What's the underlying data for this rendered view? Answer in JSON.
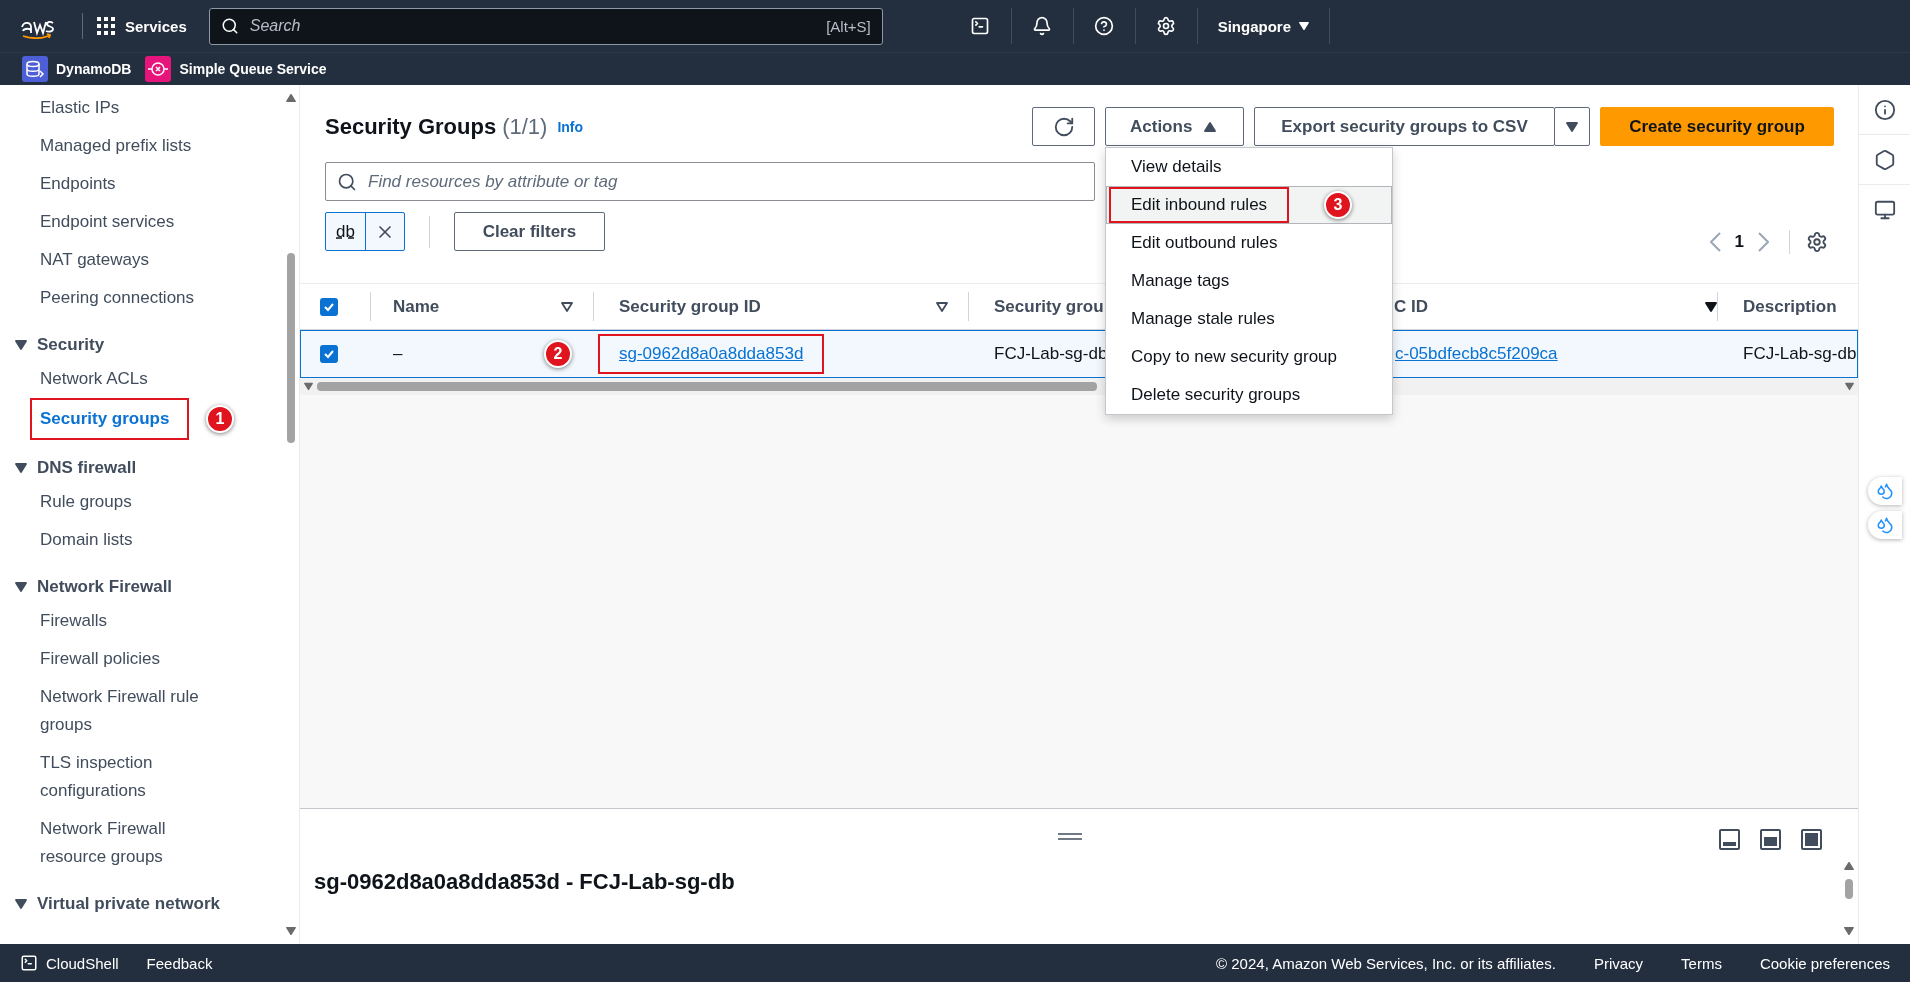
{
  "top_bar": {
    "services": "Services",
    "search": {
      "placeholder": "Search",
      "shortcut": "[Alt+S]"
    },
    "region": "Singapore"
  },
  "favorites": [
    {
      "kind": "dynamodb",
      "label": "DynamoDB"
    },
    {
      "kind": "sqs",
      "label": "Simple Queue Service"
    }
  ],
  "sidebar": {
    "items": [
      {
        "label": "Elastic IPs",
        "selected": false
      },
      {
        "label": "Managed prefix lists",
        "selected": false
      },
      {
        "label": "Endpoints",
        "selected": false
      },
      {
        "label": "Endpoint services",
        "selected": false
      },
      {
        "label": "NAT gateways",
        "selected": false
      },
      {
        "label": "Peering connections",
        "selected": false
      }
    ],
    "sections": [
      {
        "title": "Security",
        "items": [
          {
            "label": "Network ACLs",
            "selected": false
          },
          {
            "label": "Security groups",
            "selected": true,
            "callout": "1"
          }
        ]
      },
      {
        "title": "DNS firewall",
        "items": [
          {
            "label": "Rule groups",
            "selected": false
          },
          {
            "label": "Domain lists",
            "selected": false
          }
        ]
      },
      {
        "title": "Network Firewall",
        "items": [
          {
            "label": "Firewalls",
            "selected": false
          },
          {
            "label": "Firewall policies",
            "selected": false
          },
          {
            "label": "Network Firewall rule groups",
            "selected": false
          },
          {
            "label": "TLS inspection configurations",
            "selected": false
          },
          {
            "label": "Network Firewall resource groups",
            "selected": false
          }
        ]
      },
      {
        "title": "Virtual private network"
      }
    ]
  },
  "page": {
    "title": "Security Groups",
    "count": "(1/1)",
    "info": "Info",
    "actions": "Actions",
    "export": "Export security groups to CSV",
    "create": "Create security group",
    "search": {
      "placeholder": "Find resources by attribute or tag"
    },
    "filter_token": "db",
    "clear_filters": "Clear filters",
    "page_number": "1"
  },
  "actions_menu": {
    "expanded": true,
    "items": [
      {
        "label": "View details",
        "hovered": false
      },
      {
        "label": "Edit inbound rules",
        "hovered": true,
        "callout": "3"
      },
      {
        "label": "Edit outbound rules",
        "hovered": false
      },
      {
        "label": "Manage tags",
        "hovered": false
      },
      {
        "label": "Manage stale rules",
        "hovered": false
      },
      {
        "label": "Copy to new security group",
        "hovered": false
      },
      {
        "label": "Delete security groups",
        "hovered": false
      }
    ]
  },
  "table": {
    "all_checked": true,
    "columns": [
      {
        "label": "Name",
        "sorted": false
      },
      {
        "label": "Security group ID",
        "sorted": false
      },
      {
        "label": "Security grou"
      },
      {
        "label": "C ID",
        "sorted": true
      },
      {
        "label": "Description"
      }
    ],
    "rows": [
      {
        "selected": true,
        "checked": true,
        "cells": [
          {
            "kind": "text",
            "text": "–"
          },
          {
            "kind": "link",
            "text": "sg-0962d8a0a8dda853d",
            "callout": "2"
          },
          {
            "kind": "text",
            "text": "FCJ-Lab-sg-db"
          },
          {
            "kind": "link",
            "text": "c-05bdfecb8c5f209ca"
          },
          {
            "kind": "text",
            "text": "FCJ-Lab-sg-db"
          }
        ]
      }
    ]
  },
  "split_panel": {
    "title": "sg-0962d8a0a8dda853d - FCJ-Lab-sg-db"
  },
  "footer": {
    "left": [
      "CloudShell",
      "Feedback"
    ],
    "copyright": "© 2024, Amazon Web Services, Inc. or its affiliates.",
    "links": [
      "Privacy",
      "Terms",
      "Cookie preferences"
    ]
  }
}
